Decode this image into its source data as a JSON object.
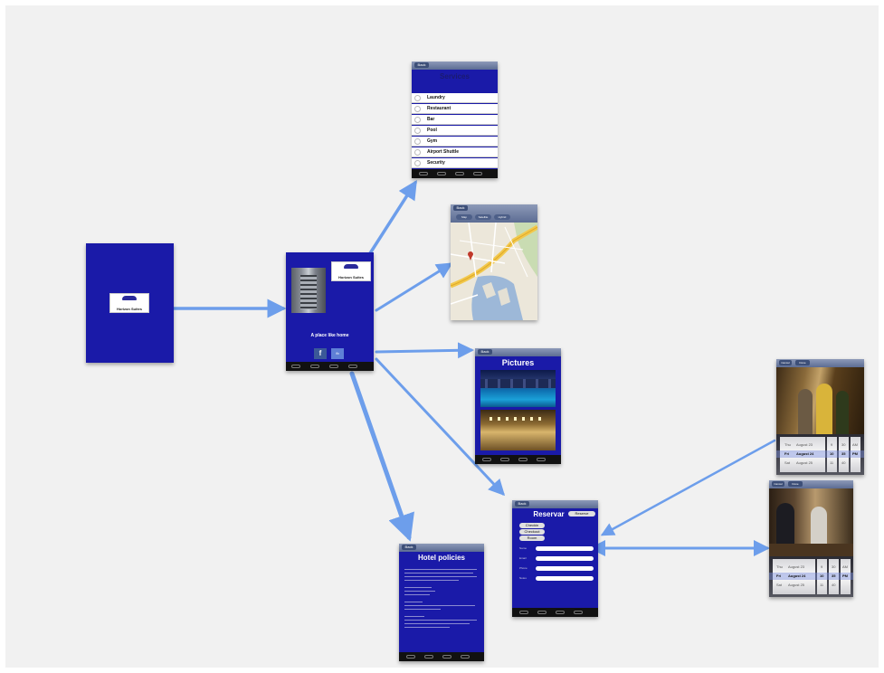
{
  "splash": {
    "logo_text": "Horizon Suites"
  },
  "home": {
    "logo_text": "Horizon Suites",
    "tagline": "A place like home",
    "share_label": "fb"
  },
  "services": {
    "back_label": "Back",
    "title": "Services",
    "items": [
      "Laundry",
      "Restaurant",
      "Bar",
      "Pool",
      "Gym",
      "Airport Shuttle",
      "Security"
    ]
  },
  "map_screen": {
    "back_label": "Back",
    "segments": [
      "Map",
      "Satellite",
      "Hybrid"
    ]
  },
  "pictures": {
    "back_label": "Back",
    "title": "Pictures"
  },
  "reservation": {
    "back_label": "Back",
    "title": "Reservar",
    "top_button": "Reserve",
    "buttons": [
      "Checkin",
      "Checkout",
      "Room"
    ],
    "field_labels": [
      "Name",
      "Email",
      "Phone",
      "Notes"
    ]
  },
  "policies": {
    "back_label": "Back",
    "title": "Hotel policies"
  },
  "date_picker_1": {
    "buttons": [
      "Cancel",
      "Done"
    ],
    "rows": [
      [
        "Thu",
        "August 23",
        "9",
        "30",
        "AM"
      ],
      [
        "Fri",
        "August 24",
        "10",
        "35",
        "PM"
      ],
      [
        "Sat",
        "August 25",
        "11",
        "40",
        ""
      ]
    ]
  },
  "date_picker_2": {
    "buttons": [
      "Cancel",
      "Done"
    ],
    "rows": [
      [
        "Thu",
        "August 23",
        "9",
        "30",
        "AM"
      ],
      [
        "Fri",
        "August 24",
        "10",
        "35",
        "PM"
      ],
      [
        "Sat",
        "August 25",
        "11",
        "40",
        ""
      ]
    ]
  },
  "colors": {
    "screen_blue": "#1a1aa8",
    "arrow_blue": "#6d9eeb",
    "background": "#f1f1f1"
  }
}
